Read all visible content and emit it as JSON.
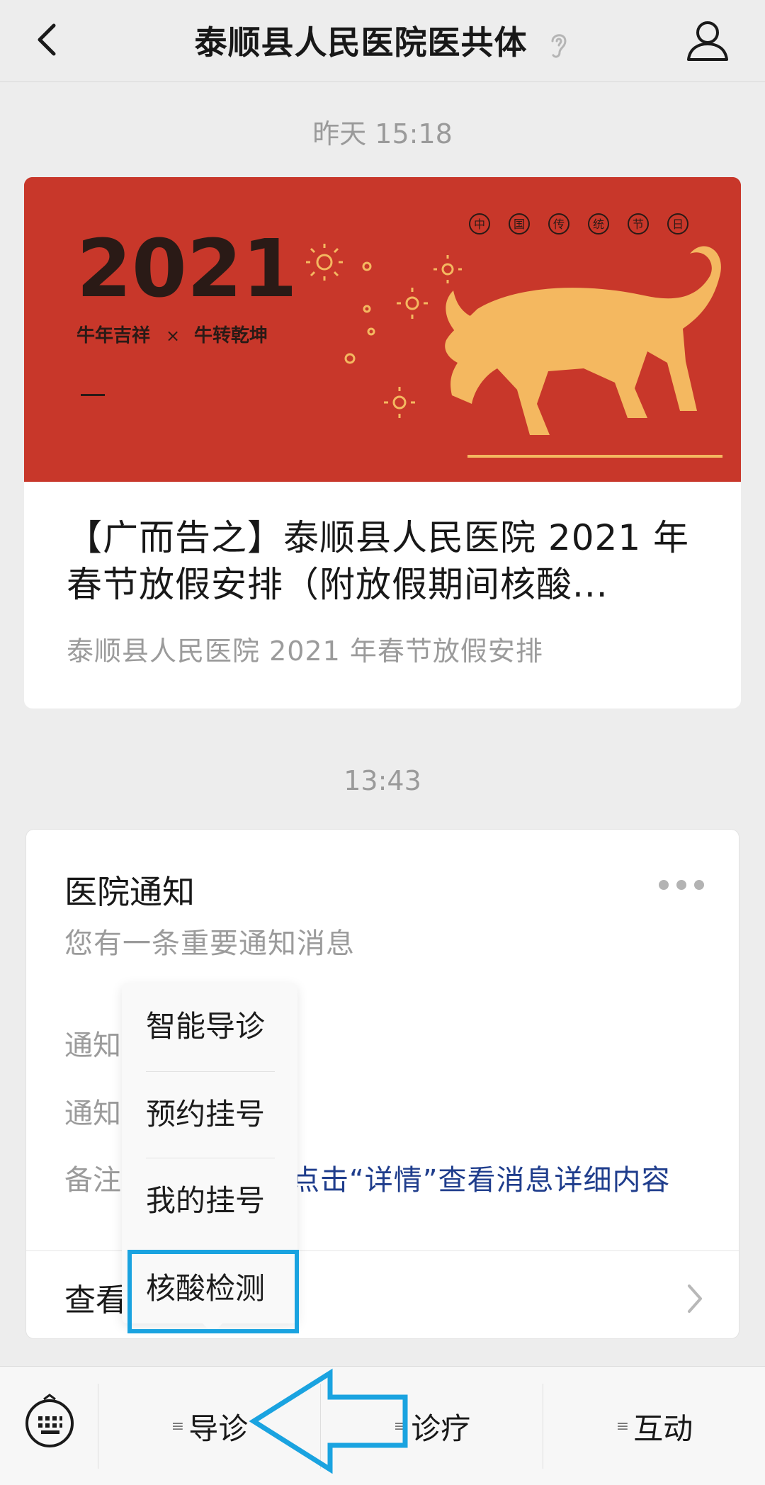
{
  "header": {
    "title": "泰顺县人民医院医共体"
  },
  "timestamps": {
    "first": "昨天 15:18",
    "second": "13:43"
  },
  "article": {
    "banner_year": "2021",
    "banner_slogan_left": "牛年吉祥",
    "banner_slogan_sep": "×",
    "banner_slogan_right": "牛转乾坤",
    "banner_tag_chars": [
      "中",
      "国",
      "传",
      "统",
      "节",
      "日"
    ],
    "title": "【广而告之】泰顺县人民医院 2021 年春节放假安排（附放假期间核酸...",
    "subtitle": "泰顺县人民医院 2021 年春节放假安排"
  },
  "notice": {
    "title": "医院通知",
    "subtitle": "您有一条重要通知消息",
    "row1_label": "通知",
    "row2_label": "通知",
    "note_label": "备注",
    "note_text": "点击“详情”查看消息详细内容",
    "view_label": "查看"
  },
  "popup_menu": {
    "items": [
      "智能导诊",
      "预约挂号",
      "我的挂号",
      "核酸检测"
    ],
    "highlighted": "核酸检测"
  },
  "bottom_bar": {
    "tabs": [
      "导诊",
      "诊疗",
      "互动"
    ],
    "tab_marker": "≡"
  },
  "colors": {
    "banner_red": "#c8372a",
    "highlight_blue": "#1aa3e0",
    "link_blue": "#1f3d8c",
    "ox_gold": "#f4b860"
  }
}
